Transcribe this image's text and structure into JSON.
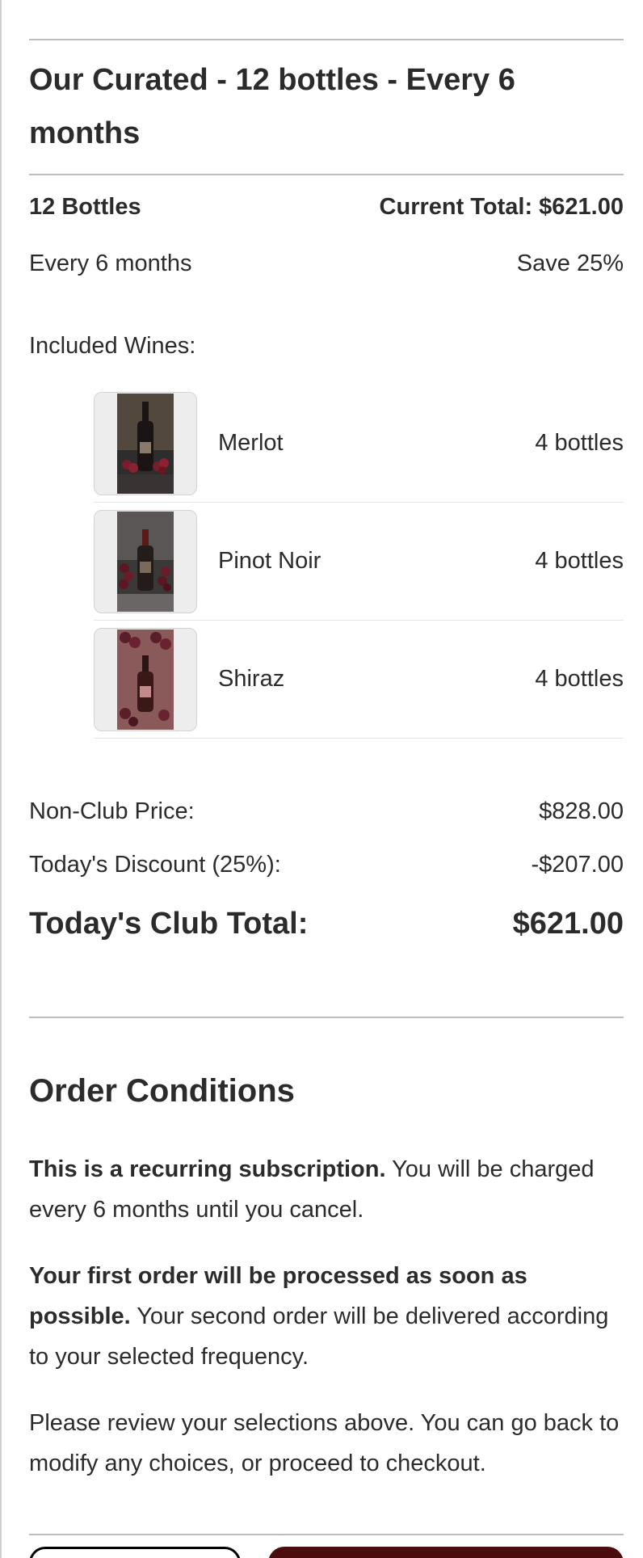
{
  "plan": {
    "title": "Our Curated - 12 bottles - Every 6 months",
    "bottles_label": "12 Bottles",
    "current_total": "Current Total: $621.00",
    "frequency": "Every 6 months",
    "savings": "Save 25%"
  },
  "included": {
    "heading": "Included Wines:",
    "wines": [
      {
        "name": "Merlot",
        "qty": "4 bottles",
        "image_icon": "wine-bottle-with-grapes"
      },
      {
        "name": "Pinot Noir",
        "qty": "4 bottles",
        "image_icon": "wine-bottle-with-grapes"
      },
      {
        "name": "Shiraz",
        "qty": "4 bottles",
        "image_icon": "wine-bottle-with-grapes"
      }
    ]
  },
  "pricing": {
    "non_club_label": "Non-Club Price:",
    "non_club_value": "$828.00",
    "discount_label": "Today's Discount (25%):",
    "discount_value": "-$207.00",
    "total_label": "Today's Club Total:",
    "total_value": "$621.00"
  },
  "conditions": {
    "title": "Order Conditions",
    "p1_bold": "This is a recurring subscription.",
    "p1_rest": " You will be charged every 6 months until you cancel.",
    "p2_bold": "Your first order will be processed as soon as possible.",
    "p2_rest": " Your second order will be delivered according to your selected frequency.",
    "p3": "Please review your selections above. You can go back to modify any choices, or proceed to checkout."
  },
  "colors": {
    "brand_dark": "#4a0c0c",
    "text": "#2b2b2b",
    "rule": "#bdbdbd"
  }
}
